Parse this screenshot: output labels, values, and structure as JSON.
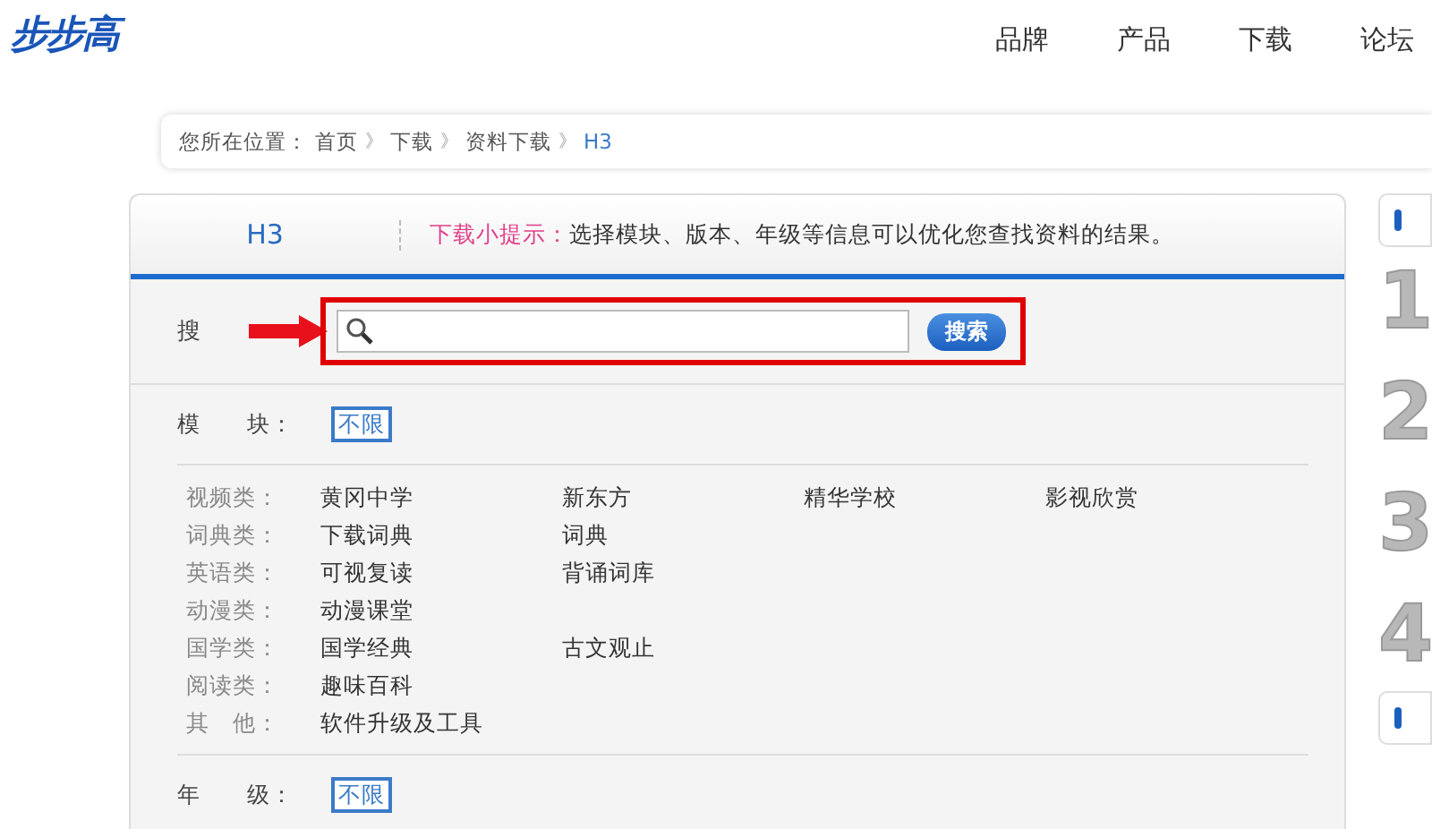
{
  "logo": "步步高",
  "nav": [
    {
      "label": "品牌"
    },
    {
      "label": "产品"
    },
    {
      "label": "下载"
    },
    {
      "label": "论坛"
    }
  ],
  "breadcrumb": {
    "prefix": "您所在位置：",
    "items": [
      {
        "label": "首页",
        "current": false
      },
      {
        "label": "下载",
        "current": false
      },
      {
        "label": "资料下载",
        "current": false
      },
      {
        "label": "H3",
        "current": true
      }
    ],
    "separator": "》"
  },
  "panel": {
    "title": "H3",
    "tip_label": "下载小提示：",
    "tip": "选择模块、版本、年级等信息可以优化您查找资料的结果。"
  },
  "search": {
    "label": "搜",
    "button": "搜索",
    "highlighted": true
  },
  "module_filter": {
    "label": "模　　块：",
    "options": [
      {
        "label": "不限",
        "selected": true
      }
    ]
  },
  "categories": [
    {
      "label": "视频类：",
      "items": [
        "黄冈中学",
        "新东方",
        "精华学校",
        "影视欣赏"
      ]
    },
    {
      "label": "词典类：",
      "items": [
        "下载词典",
        "词典"
      ]
    },
    {
      "label": "英语类：",
      "items": [
        "可视复读",
        "背诵词库"
      ]
    },
    {
      "label": "动漫类：",
      "items": [
        "动漫课堂"
      ]
    },
    {
      "label": "国学类：",
      "items": [
        "国学经典",
        "古文观止"
      ]
    },
    {
      "label": "阅读类：",
      "items": [
        "趣味百科"
      ]
    },
    {
      "label": "其　他：",
      "items": [
        "软件升级及工具"
      ]
    }
  ],
  "grade_filter": {
    "label": "年　　级：",
    "options": [
      {
        "label": "不限",
        "selected": true
      }
    ]
  },
  "side_steps": [
    "1",
    "2",
    "3",
    "4"
  ]
}
